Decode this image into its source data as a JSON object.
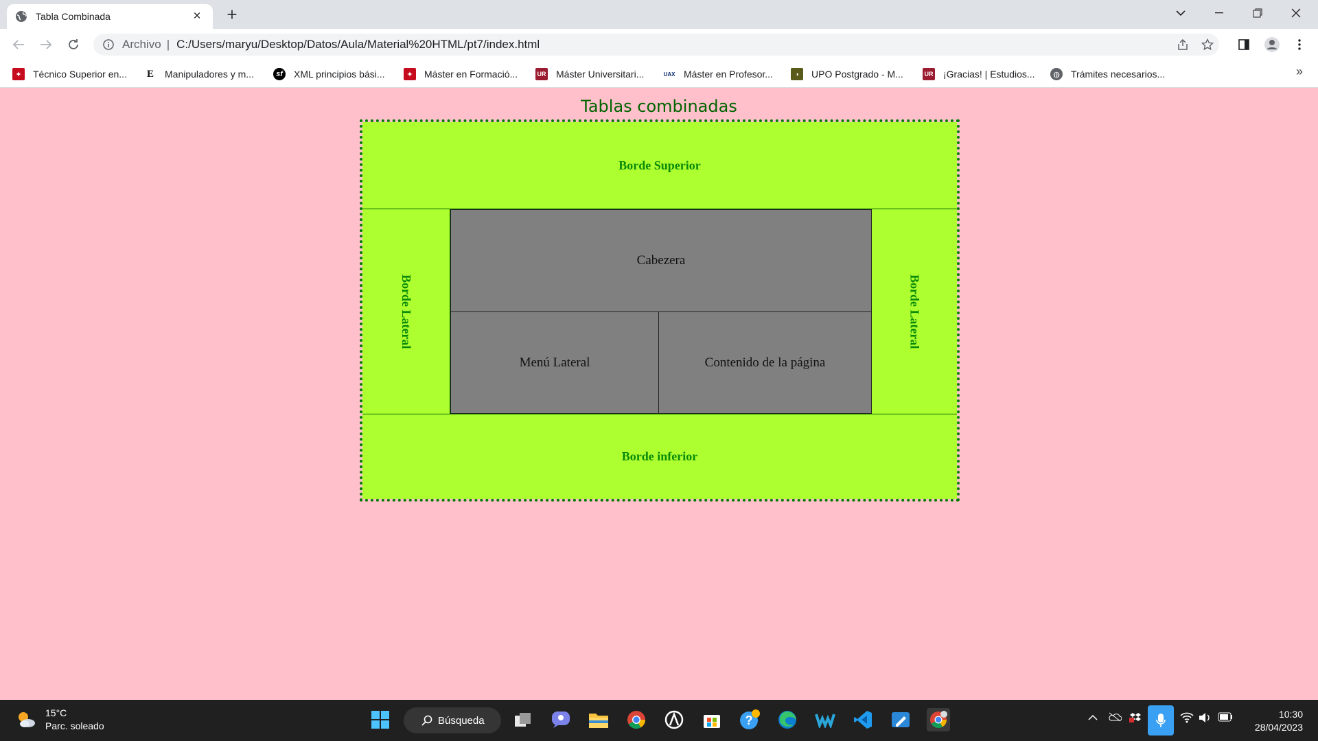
{
  "browser": {
    "tab_title": "Tabla Combinada",
    "omnibox_label": "Archivo",
    "omnibox_sep": "|",
    "url": "C:/Users/maryu/Desktop/Datos/Aula/Material%20HTML/pt7/index.html"
  },
  "bookmarks": [
    {
      "label": "Técnico Superior en...",
      "color": "#c60b1e"
    },
    {
      "label": "Manipuladores y m...",
      "color": "#111111"
    },
    {
      "label": "XML principios bási...",
      "color": "#000000"
    },
    {
      "label": "Máster en Formació...",
      "color": "#c60b1e"
    },
    {
      "label": "Máster Universitari...",
      "color": "#9b1b30"
    },
    {
      "label": "Máster en Profesor...",
      "color": "#0b2a6f"
    },
    {
      "label": "UPO Postgrado - M...",
      "color": "#5a5a1a"
    },
    {
      "label": "¡Gracias! | Estudios...",
      "color": "#9b1b30"
    },
    {
      "label": "Trámites necesarios...",
      "color": "#5f6368"
    }
  ],
  "page": {
    "heading": "Tablas combinadas",
    "top": "Borde Superior",
    "left": "Borde Lateral",
    "right": "Borde Lateral",
    "header": "Cabezera",
    "menu": "Menú Lateral",
    "content": "Contenido de la página",
    "bottom": "Borde inferior"
  },
  "colors": {
    "page_bg": "#ffc0cb",
    "green_cell": "#adff2f",
    "green_text": "#0a8a0a",
    "grey_cell": "#808080"
  },
  "taskbar": {
    "temperature": "15°C",
    "weather": "Parc. soleado",
    "search": "Búsqueda",
    "time": "10:30",
    "date": "28/04/2023",
    "apps": [
      "windows-start-icon",
      "task-view-icon",
      "chat-icon",
      "file-explorer-icon",
      "chrome-icon",
      "app-icon",
      "store-icon",
      "help-icon",
      "edge-icon",
      "webex-icon",
      "vscode-icon",
      "paint-icon",
      "chrome-profile-icon"
    ]
  }
}
